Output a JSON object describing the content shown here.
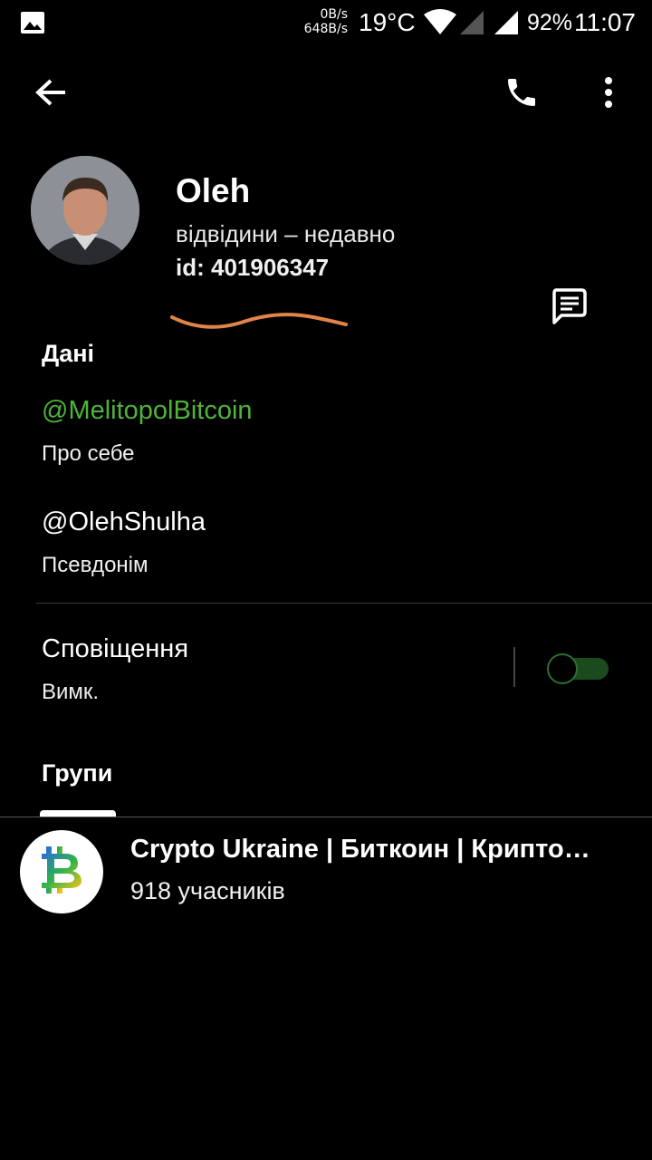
{
  "status_bar": {
    "net_up": "0B/s",
    "net_down": "648B/s",
    "temperature": "19°C",
    "battery": "92%",
    "time": "11:07"
  },
  "profile": {
    "name": "Oleh",
    "last_seen": "відвідини – недавно",
    "id": "id: 401906347"
  },
  "info": {
    "section_title": "Дані",
    "about_value": "@MelitopolBitcoin",
    "about_label": "Про себе",
    "username_value": "@OlehShulha",
    "username_label": "Псевдонім"
  },
  "notifications": {
    "title": "Сповіщення",
    "state": "Вимк.",
    "enabled": false
  },
  "groups": {
    "section_title": "Групи",
    "items": [
      {
        "name": "Crypto Ukraine | Биткоин | Крипто…",
        "members": "918 учасників"
      }
    ]
  },
  "colors": {
    "accent_green": "#4fb33a",
    "annotation_stroke": "#e0854a"
  },
  "icons": {
    "back": "arrow-left",
    "call": "phone",
    "menu": "more-vertical",
    "message": "chat-bubble"
  }
}
